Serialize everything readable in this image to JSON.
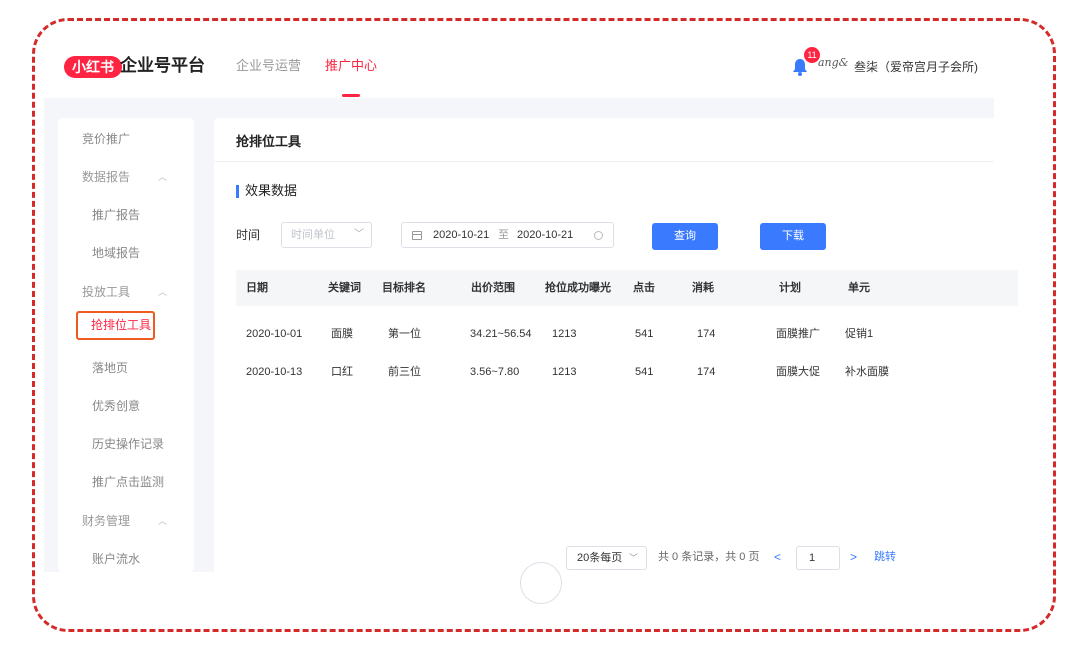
{
  "header": {
    "logo": "小红书",
    "brand": "企业号平台",
    "nav": [
      {
        "label": "企业号运营",
        "active": false
      },
      {
        "label": "推广中心",
        "active": true
      }
    ],
    "notification_count": "11",
    "brand_mark": "ang&",
    "user": "叁柒（爱帝宫月子会所)"
  },
  "sidebar": {
    "top_item": "竞价推广",
    "groups": [
      {
        "label": "数据报告",
        "items": [
          "推广报告",
          "地域报告"
        ]
      },
      {
        "label": "投放工具",
        "items": [
          "抢排位工具",
          "落地页",
          "优秀创意",
          "历史操作记录",
          "推广点击监测"
        ]
      },
      {
        "label": "财务管理",
        "items": [
          "账户流水"
        ]
      }
    ],
    "active": "抢排位工具"
  },
  "main": {
    "title": "抢排位工具",
    "section": "效果数据",
    "filter": {
      "time_label": "时间",
      "unit_placeholder": "时间单位",
      "date_start": "2020-10-21",
      "date_separator": "至",
      "date_end": "2020-10-21",
      "query_button": "查询",
      "download_button": "下载"
    },
    "table": {
      "columns": [
        "日期",
        "关键词",
        "目标排名",
        "出价范围",
        "抢位成功曝光",
        "点击",
        "消耗",
        "计划",
        "单元"
      ],
      "rows": [
        [
          "2020-10-01",
          "面膜",
          "第一位",
          "34.21~56.54",
          "1213",
          "541",
          "174",
          "面膜推广",
          "促销1"
        ],
        [
          "2020-10-13",
          "口红",
          "前三位",
          "3.56~7.80",
          "1213",
          "541",
          "174",
          "面膜大促",
          "补水面膜"
        ]
      ]
    },
    "pagination": {
      "page_size": "20条每页",
      "total": "共 0 条记录，共 0 页",
      "current_page": "1",
      "jump": "跳转"
    }
  }
}
